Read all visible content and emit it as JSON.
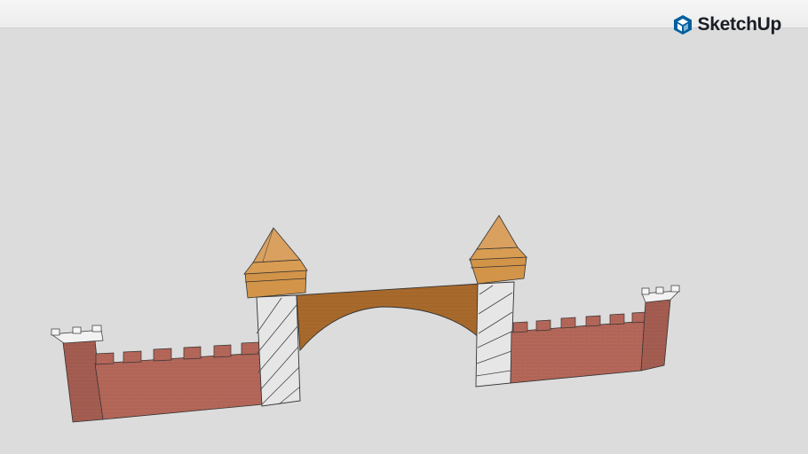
{
  "app": {
    "brand": "SketchUp",
    "logo_icon": "sketchup-cube-icon",
    "accent": "#005F9E"
  },
  "model": {
    "description_colors": {
      "brick": "#B8695C",
      "wood": "#C9873D",
      "stone": "#E4E4E4",
      "viewport_bg": "#DCDCDC"
    }
  }
}
